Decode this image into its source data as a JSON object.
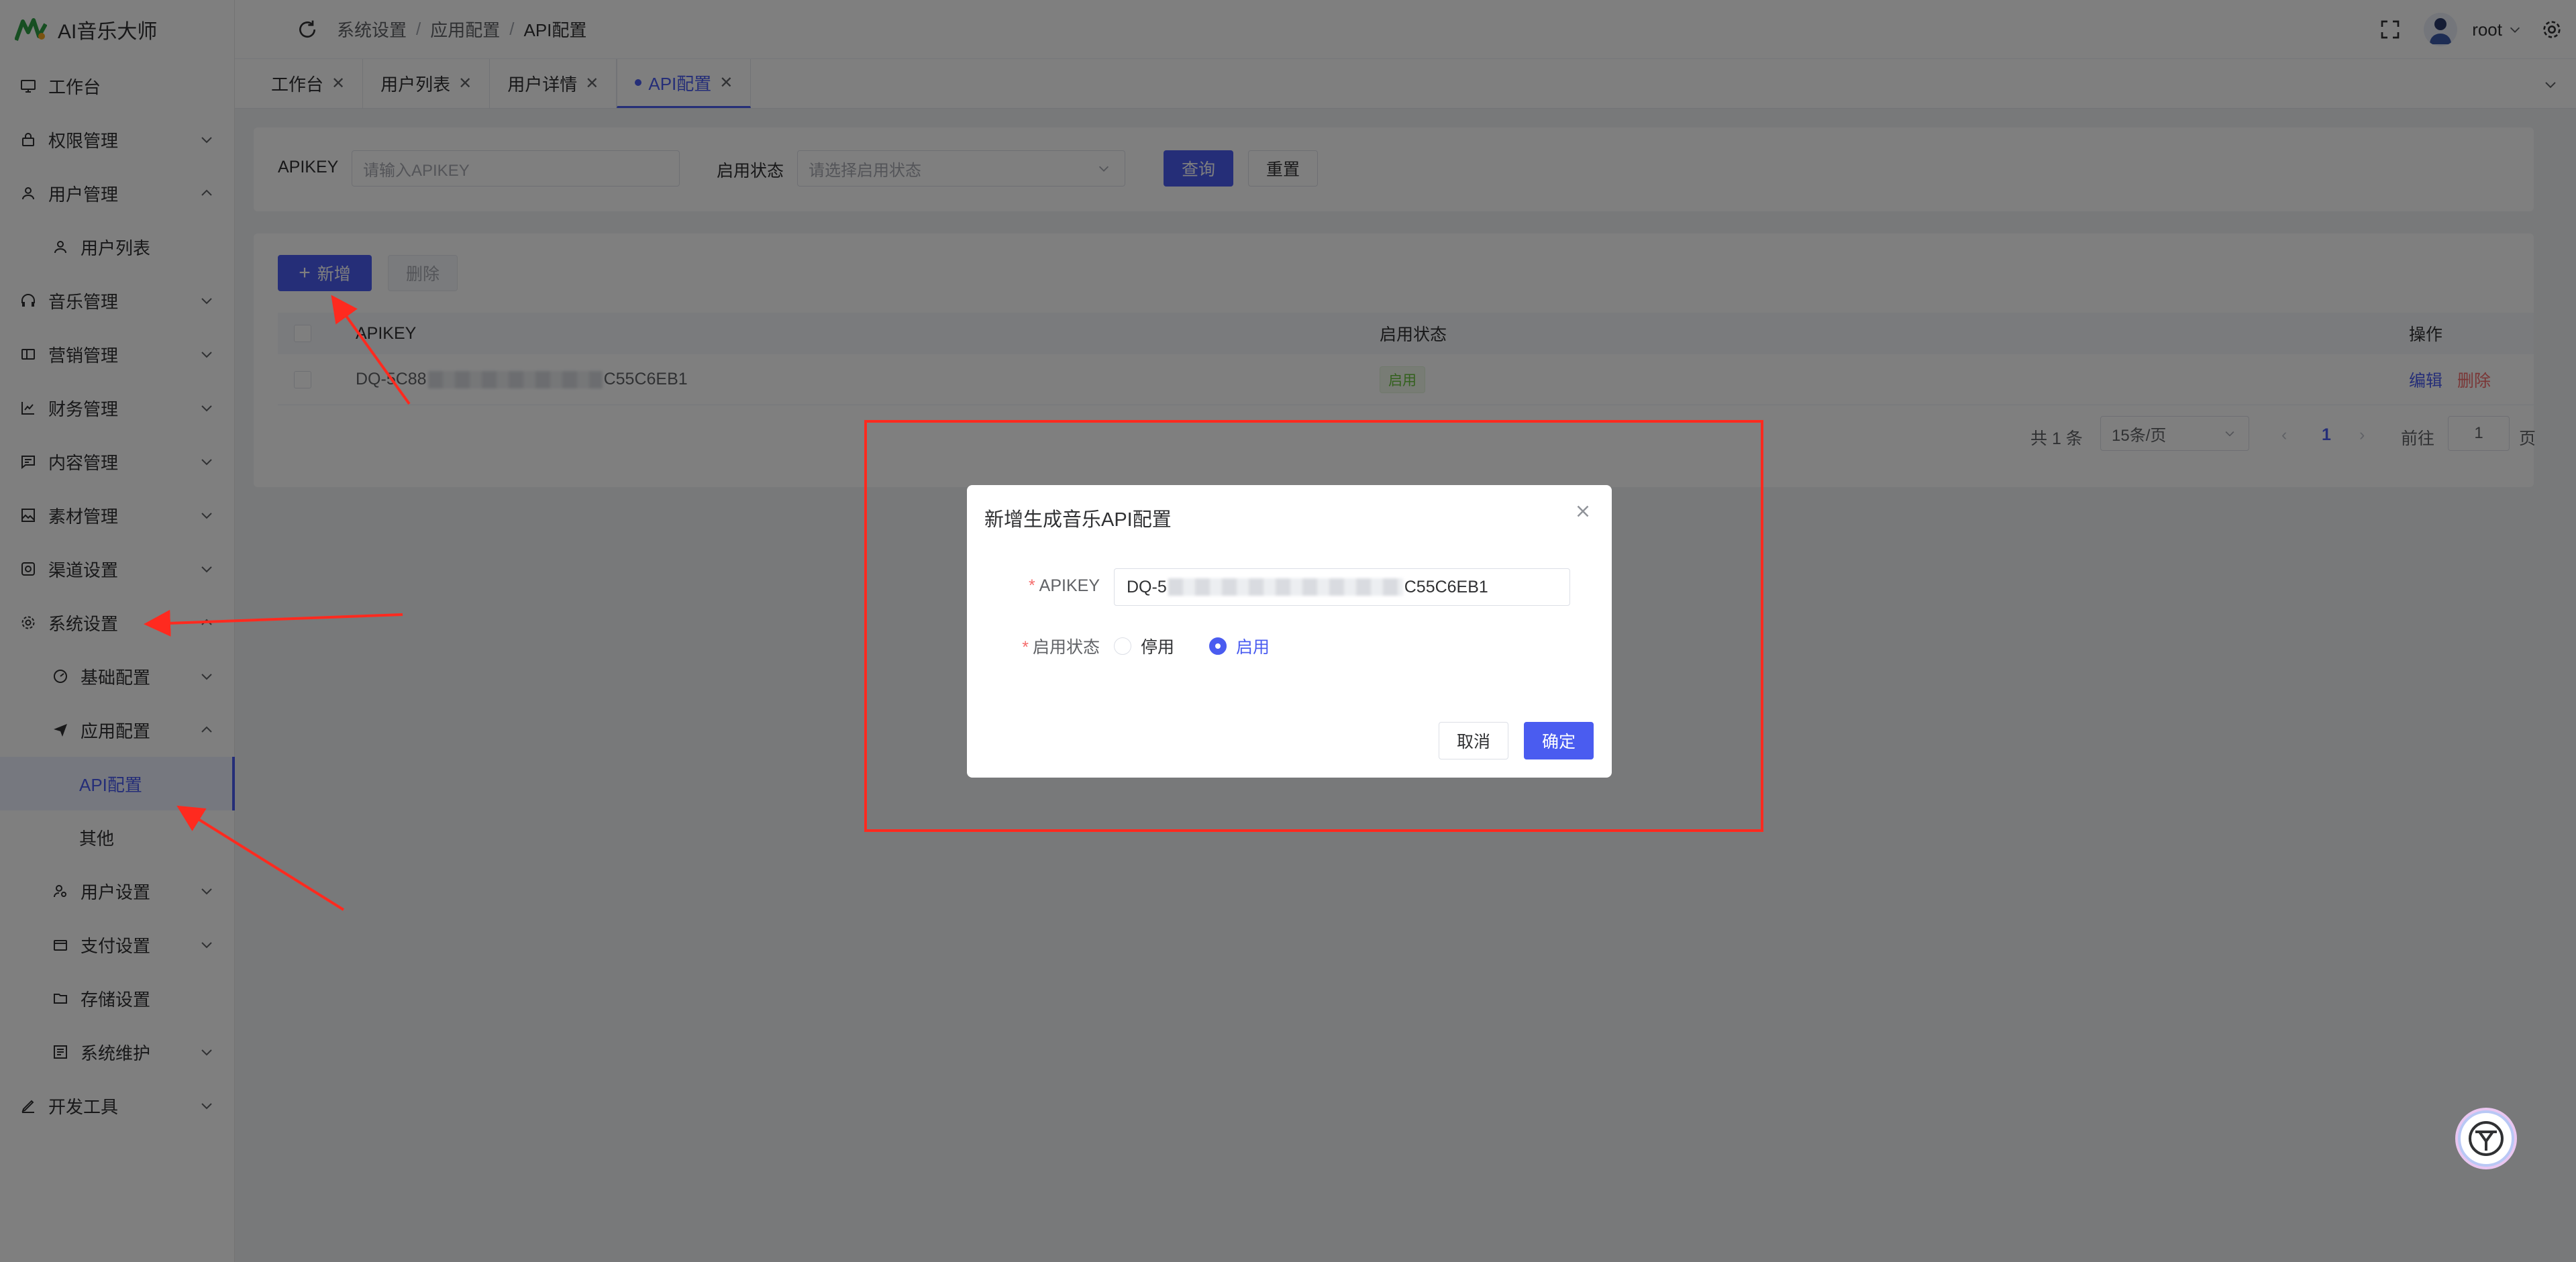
{
  "app": {
    "title": "AI音乐大师"
  },
  "sidebar": {
    "items": [
      {
        "label": "工作台",
        "icon": "monitor-icon"
      },
      {
        "label": "权限管理",
        "icon": "lock-icon"
      },
      {
        "label": "用户管理",
        "icon": "user-icon"
      },
      {
        "label": "用户列表",
        "icon": "user-icon"
      },
      {
        "label": "音乐管理",
        "icon": "headphones-icon"
      },
      {
        "label": "营销管理",
        "icon": "coupon-icon"
      },
      {
        "label": "财务管理",
        "icon": "chart-icon"
      },
      {
        "label": "内容管理",
        "icon": "message-icon"
      },
      {
        "label": "素材管理",
        "icon": "picture-icon"
      },
      {
        "label": "渠道设置",
        "icon": "camera-icon"
      },
      {
        "label": "系统设置",
        "icon": "gear-icon"
      },
      {
        "label": "基础配置",
        "icon": "dashboard-icon"
      },
      {
        "label": "应用配置",
        "icon": "send-icon"
      },
      {
        "label": "API配置"
      },
      {
        "label": "其他"
      },
      {
        "label": "用户设置",
        "icon": "user-settings-icon"
      },
      {
        "label": "支付设置",
        "icon": "wallet-icon"
      },
      {
        "label": "存储设置",
        "icon": "folder-icon"
      },
      {
        "label": "系统维护",
        "icon": "maintenance-icon"
      },
      {
        "label": "开发工具",
        "icon": "pen-icon"
      }
    ]
  },
  "header": {
    "breadcrumb": [
      "系统设置",
      "应用配置",
      "API配置"
    ],
    "separator": "/",
    "username": "root"
  },
  "tabs": [
    {
      "label": "工作台"
    },
    {
      "label": "用户列表"
    },
    {
      "label": "用户详情"
    },
    {
      "label": "API配置",
      "active": true
    }
  ],
  "search": {
    "apikey_label": "APIKEY",
    "apikey_placeholder": "请输入APIKEY",
    "status_label": "启用状态",
    "status_placeholder": "请选择启用状态",
    "query_label": "查询",
    "reset_label": "重置"
  },
  "toolbar": {
    "add_label": "新增",
    "delete_label": "删除"
  },
  "table": {
    "columns": [
      "APIKEY",
      "启用状态",
      "操作"
    ],
    "rows": [
      {
        "apikey_start": "DQ-5C88",
        "apikey_end": "C55C6EB1",
        "status": "启用",
        "edit": "编辑",
        "delete": "删除"
      }
    ]
  },
  "pagination": {
    "total": "共 1 条",
    "page_size": "15条/页",
    "current": "1",
    "goto_label": "前往",
    "goto_value": "1",
    "goto_suffix": "页"
  },
  "dialog": {
    "title": "新增生成音乐API配置",
    "apikey_label": "APIKEY",
    "apikey_value_start": "DQ-5",
    "apikey_value_end": "C55C6EB1",
    "status_label": "启用状态",
    "required_mark": "*",
    "option_disabled": "停用",
    "option_enabled": "启用",
    "selected": "启用",
    "cancel_label": "取消",
    "confirm_label": "确定"
  },
  "colors": {
    "primary": "#4a5cf0",
    "danger": "#f56c6c",
    "success": "#67c23a",
    "annotation": "#ff2a1f"
  }
}
